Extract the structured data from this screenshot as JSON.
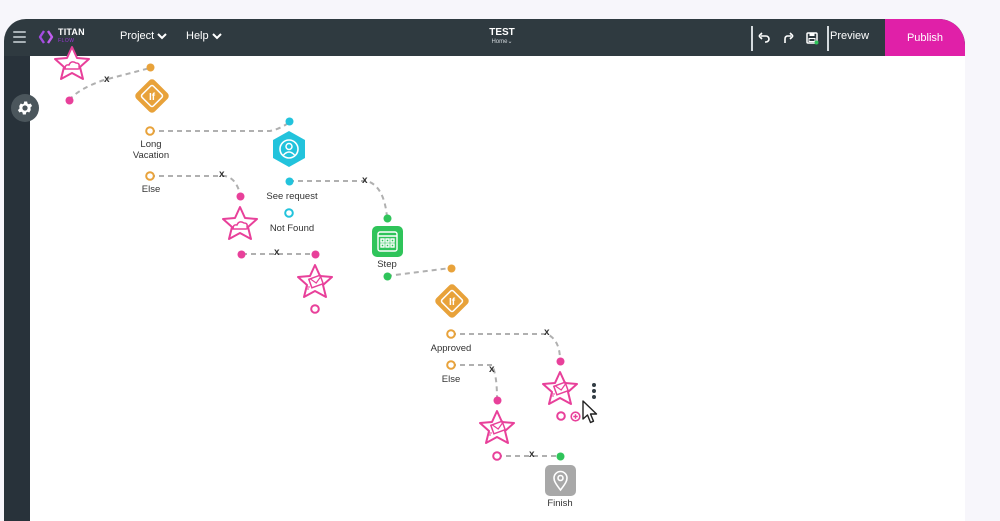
{
  "header": {
    "logo_title": "TITAN",
    "logo_subtitle": "FLOW",
    "menus": [
      {
        "label": "Project"
      },
      {
        "label": "Help"
      }
    ],
    "page_title": "TEST",
    "page_subtitle": "Home",
    "preview_label": "Preview",
    "publish_label": "Publish"
  },
  "colors": {
    "topbar": "#2f3a40",
    "sidebar": "#28323a",
    "publish": "#e020a8",
    "star_pink": "#e8409a",
    "if_orange": "#e8a23a",
    "user_cyan": "#22c3dc",
    "step_green": "#2fc45a",
    "finish_gray": "#a8a8a8",
    "connector": "#b0b0b0"
  },
  "flow": {
    "nodes": [
      {
        "id": "cloud-1",
        "type": "star-cloud",
        "label": ""
      },
      {
        "id": "if-1",
        "type": "if",
        "label": "If"
      },
      {
        "id": "see-request",
        "type": "user",
        "label": ""
      },
      {
        "id": "cloud-2",
        "type": "star-cloud",
        "label": ""
      },
      {
        "id": "mail-1",
        "type": "star-mail",
        "label": ""
      },
      {
        "id": "step",
        "type": "step",
        "label": "Step"
      },
      {
        "id": "if-2",
        "type": "if",
        "label": "If"
      },
      {
        "id": "mail-2",
        "type": "star-mail",
        "label": ""
      },
      {
        "id": "mail-3",
        "type": "star-mail",
        "label": ""
      },
      {
        "id": "finish",
        "type": "finish",
        "label": "Finish"
      }
    ],
    "labels": {
      "long_vacation": [
        "Long",
        "Vacation"
      ],
      "else_1": "Else",
      "see_request": "See request",
      "not_found": "Not Found",
      "approved": "Approved",
      "else_2": "Else",
      "step": "Step",
      "finish": "Finish"
    },
    "delete_marker": "x"
  }
}
